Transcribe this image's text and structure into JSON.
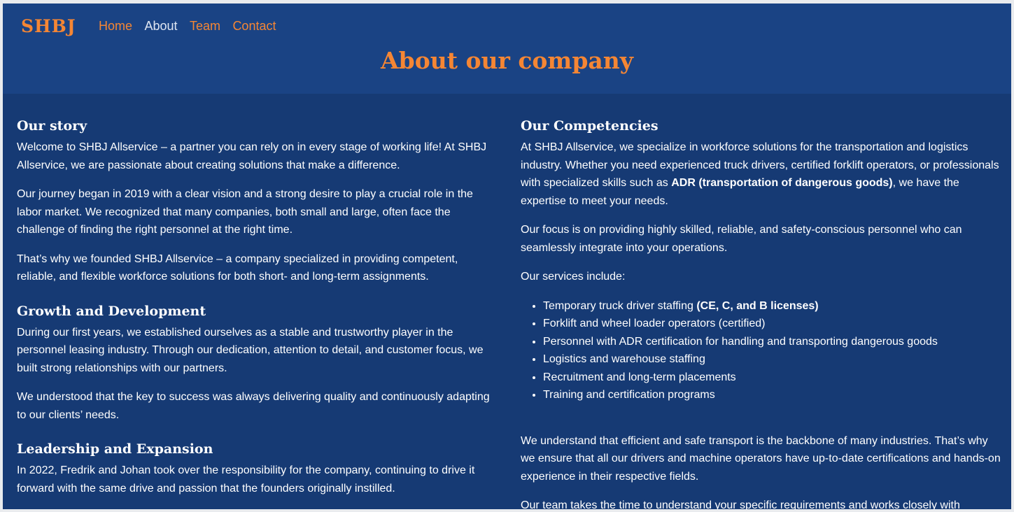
{
  "header": {
    "logo": "SHBJ",
    "nav": [
      "Home",
      "About",
      "Team",
      "Contact"
    ],
    "page_title": "About our company"
  },
  "left": {
    "story_heading": "Our story",
    "story_p1": "Welcome to SHBJ Allservice – a partner you can rely on in every stage of working life! At SHBJ Allservice, we are passionate about creating solutions that make a difference.",
    "story_p2": "Our journey began in 2019 with a clear vision and a strong desire to play a crucial role in the labor market. We recognized that many companies, both small and large, often face the challenge of finding the right personnel at the right time.",
    "story_p3": "That’s why we founded SHBJ Allservice – a company specialized in providing competent, reliable, and flexible workforce solutions for both short- and long-term assignments.",
    "growth_heading": "Growth and Development",
    "growth_p1": "During our first years, we established ourselves as a stable and trustworthy player in the personnel leasing industry. Through our dedication, attention to detail, and customer focus, we built strong relationships with our partners.",
    "growth_p2": "We understood that the key to success was always delivering quality and continuously adapting to our clients’ needs.",
    "leadership_heading": "Leadership and Expansion",
    "leadership_p1": "In 2022, Fredrik and Johan took over the responsibility for the company, continuing to drive it forward with the same drive and passion that the founders originally instilled."
  },
  "right": {
    "competencies_heading": "Our Competencies",
    "comp_p1_a": "At SHBJ Allservice, we specialize in workforce solutions for the transportation and logistics industry. Whether you need experienced truck drivers, certified forklift operators, or professionals with specialized skills such as ",
    "comp_p1_bold": "ADR (transportation of dangerous goods)",
    "comp_p1_b": ", we have the expertise to meet your needs.",
    "comp_p2": "Our focus is on providing highly skilled, reliable, and safety-conscious personnel who can seamlessly integrate into your operations.",
    "comp_p3": "Our services include:",
    "service1_a": "Temporary truck driver staffing ",
    "service1_bold": "(CE, C, and B licenses)",
    "services": [
      "Forklift and wheel loader operators (certified)",
      "Personnel with ADR certification for handling and transporting dangerous goods",
      "Logistics and warehouse staffing",
      "Recruitment and long-term placements",
      "Training and certification programs"
    ],
    "comp_p4": "We understand that efficient and safe transport is the backbone of many industries. That’s why we ensure that all our drivers and machine operators have up-to-date certifications and hands-on experience in their respective fields.",
    "comp_p5": "Our team takes the time to understand your specific requirements and works closely with"
  }
}
